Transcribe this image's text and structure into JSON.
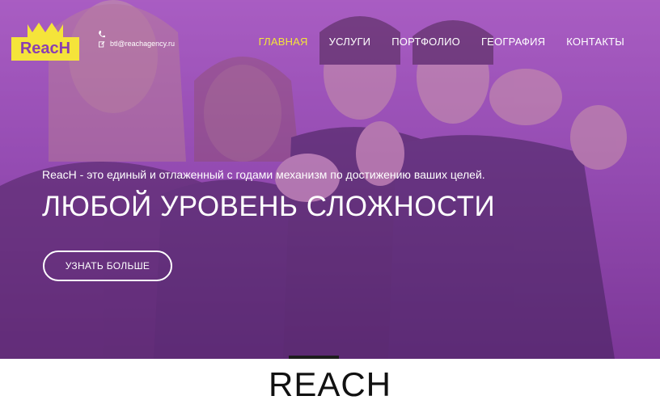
{
  "header": {
    "logo_text": "ReacH",
    "phone_icon": "phone-icon",
    "email_icon": "edit-icon",
    "email": "btl@reachagency.ru"
  },
  "nav": {
    "items": [
      {
        "label": "ГЛАВНАЯ",
        "active": true
      },
      {
        "label": "УСЛУГИ"
      },
      {
        "label": "ПОРТФОЛИО"
      },
      {
        "label": "ГЕОГРАФИЯ"
      },
      {
        "label": "КОНТАКТЫ"
      }
    ]
  },
  "hero": {
    "lead": "ReacH - это единый и отлаженный с годами механизм по достижению ваших целей.",
    "headline": "ЛЮБОЙ УРОВЕНЬ СЛОЖНОСТИ",
    "cta_label": "УЗНАТЬ БОЛЬШЕ"
  },
  "section": {
    "title": "REACH"
  },
  "colors": {
    "accent": "#f5e43a",
    "hero_tint": "#a35cc4",
    "text_dark": "#111111"
  }
}
